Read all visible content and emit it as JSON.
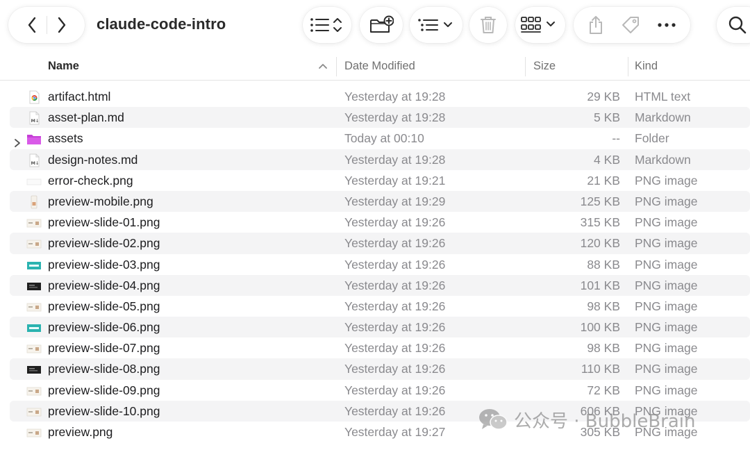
{
  "window": {
    "title": "claude-code-intro"
  },
  "columns": {
    "name": "Name",
    "date": "Date Modified",
    "size": "Size",
    "kind": "Kind"
  },
  "files": [
    {
      "name": "artifact.html",
      "date": "Yesterday at 19:28",
      "size": "29 KB",
      "kind": "HTML text",
      "icon": "chrome-html-icon"
    },
    {
      "name": "asset-plan.md",
      "date": "Yesterday at 19:28",
      "size": "5 KB",
      "kind": "Markdown",
      "icon": "markdown-file-icon"
    },
    {
      "name": "assets",
      "date": "Today at 00:10",
      "size": "--",
      "kind": "Folder",
      "icon": "folder-icon"
    },
    {
      "name": "design-notes.md",
      "date": "Yesterday at 19:28",
      "size": "4 KB",
      "kind": "Markdown",
      "icon": "markdown-file-icon"
    },
    {
      "name": "error-check.png",
      "date": "Yesterday at 19:21",
      "size": "21 KB",
      "kind": "PNG image",
      "icon": "blank-image-icon"
    },
    {
      "name": "preview-mobile.png",
      "date": "Yesterday at 19:29",
      "size": "125 KB",
      "kind": "PNG image",
      "icon": "mobile-image-icon"
    },
    {
      "name": "preview-slide-01.png",
      "date": "Yesterday at 19:26",
      "size": "315 KB",
      "kind": "PNG image",
      "icon": "slide-thumb-light-icon"
    },
    {
      "name": "preview-slide-02.png",
      "date": "Yesterday at 19:26",
      "size": "120 KB",
      "kind": "PNG image",
      "icon": "slide-thumb-light-icon"
    },
    {
      "name": "preview-slide-03.png",
      "date": "Yesterday at 19:26",
      "size": "88 KB",
      "kind": "PNG image",
      "icon": "slide-thumb-teal-icon"
    },
    {
      "name": "preview-slide-04.png",
      "date": "Yesterday at 19:26",
      "size": "101 KB",
      "kind": "PNG image",
      "icon": "slide-thumb-dark-icon"
    },
    {
      "name": "preview-slide-05.png",
      "date": "Yesterday at 19:26",
      "size": "98 KB",
      "kind": "PNG image",
      "icon": "slide-thumb-light-icon"
    },
    {
      "name": "preview-slide-06.png",
      "date": "Yesterday at 19:26",
      "size": "100 KB",
      "kind": "PNG image",
      "icon": "slide-thumb-teal-icon"
    },
    {
      "name": "preview-slide-07.png",
      "date": "Yesterday at 19:26",
      "size": "98 KB",
      "kind": "PNG image",
      "icon": "slide-thumb-light-icon"
    },
    {
      "name": "preview-slide-08.png",
      "date": "Yesterday at 19:26",
      "size": "110 KB",
      "kind": "PNG image",
      "icon": "slide-thumb-dark-icon"
    },
    {
      "name": "preview-slide-09.png",
      "date": "Yesterday at 19:26",
      "size": "72 KB",
      "kind": "PNG image",
      "icon": "slide-thumb-light-icon"
    },
    {
      "name": "preview-slide-10.png",
      "date": "Yesterday at 19:26",
      "size": "606 KB",
      "kind": "PNG image",
      "icon": "slide-thumb-light-icon"
    },
    {
      "name": "preview.png",
      "date": "Yesterday at 19:27",
      "size": "305 KB",
      "kind": "PNG image",
      "icon": "slide-thumb-light-icon"
    }
  ],
  "watermark": {
    "text": "公众号 · BubbleBrain"
  },
  "colors": {
    "folder": "#c53fd6",
    "teal": "#2bb3b0",
    "dark": "#1f1f1f",
    "alt_row": "#f4f4f5"
  }
}
